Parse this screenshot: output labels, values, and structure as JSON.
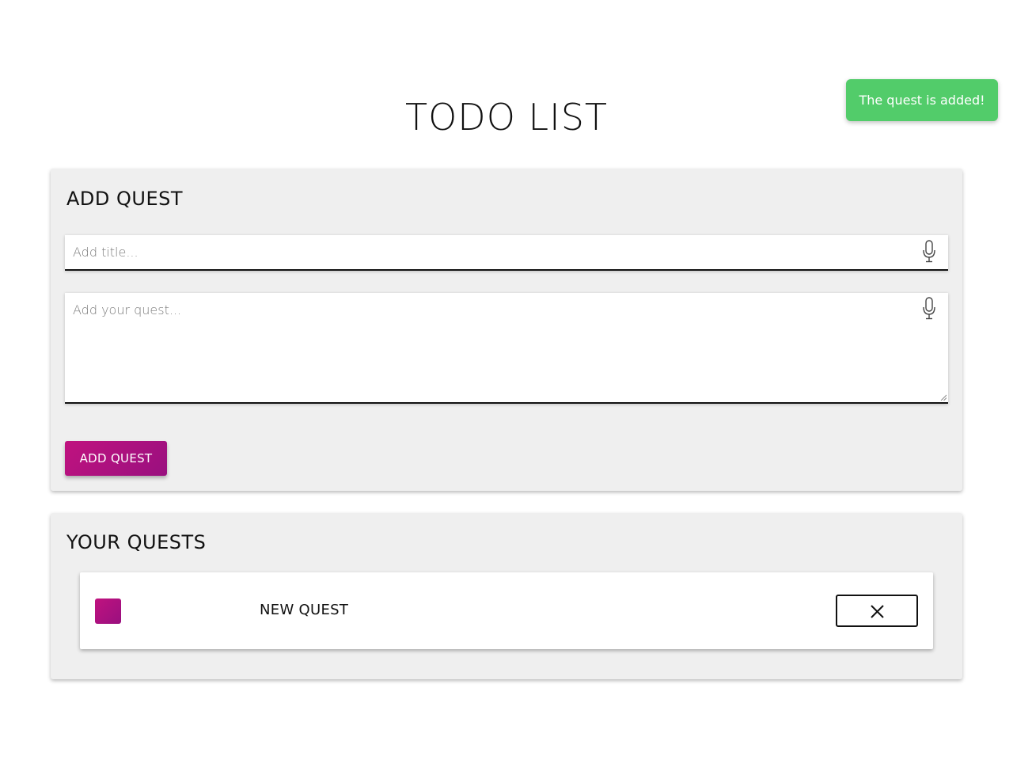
{
  "page": {
    "title": "TODO LIST"
  },
  "toast": {
    "message": "The quest is added!",
    "color": "#52cc6a"
  },
  "add_panel": {
    "heading": "ADD QUEST",
    "title_input": {
      "placeholder": "Add title...",
      "value": "",
      "icon": "mic-icon"
    },
    "quest_input": {
      "placeholder": "Add your quest...",
      "value": "",
      "icon": "mic-icon"
    },
    "submit_label": "ADD QUEST",
    "accent_color": "#b0127f"
  },
  "list_panel": {
    "heading": "YOUR QUESTS",
    "items": [
      {
        "title": "NEW QUEST",
        "checkbox_icon": "checkbox",
        "delete_icon": "close-icon"
      }
    ]
  }
}
